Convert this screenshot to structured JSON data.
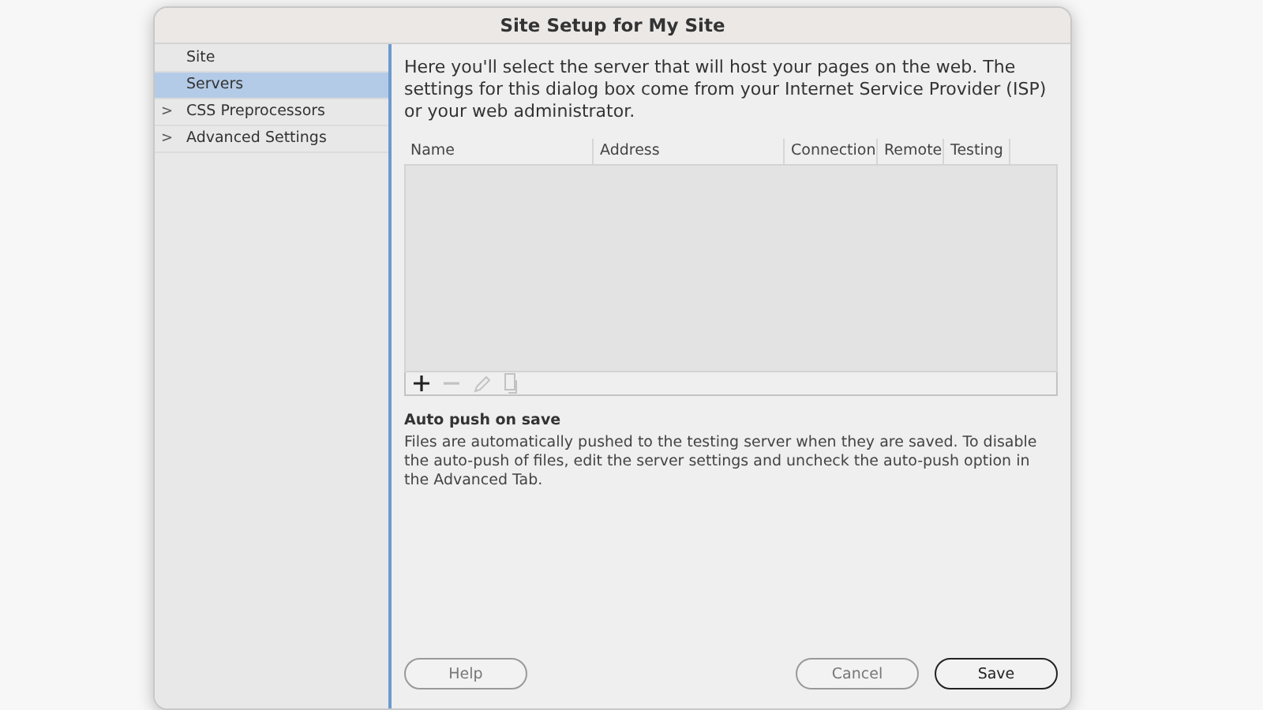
{
  "window": {
    "title": "Site Setup for My Site"
  },
  "sidebar": {
    "items": [
      {
        "label": "Site",
        "selected": false
      },
      {
        "label": "Servers",
        "selected": true
      },
      {
        "label": "CSS Preprocessors",
        "selected": false,
        "toggle": ">"
      },
      {
        "label": "Advanced Settings",
        "selected": false,
        "toggle": ">"
      }
    ]
  },
  "intro": "Here you'll select the server that will host your pages on the web. The settings for this dialog box come from your Internet Service Provider (ISP) or your web administrator.",
  "table": {
    "columns": [
      "Name",
      "Address",
      "Connection",
      "Remote",
      "Testing"
    ]
  },
  "toolbar": [
    {
      "kind": "add",
      "disabled": false
    },
    {
      "kind": "remove",
      "disabled": true
    },
    {
      "kind": "edit",
      "disabled": true
    },
    {
      "kind": "duplicate",
      "disabled": true
    }
  ],
  "note": {
    "heading": "Auto push on save",
    "text": "Files are automatically pushed to the testing server when they are saved. To disable the auto-push of files, edit the server settings and uncheck the auto-push option in the Advanced Tab."
  },
  "buttons": [
    {
      "label": "Help",
      "default": false
    },
    {
      "label": "Cancel",
      "default": false
    },
    {
      "label": "Save",
      "default": true
    }
  ]
}
